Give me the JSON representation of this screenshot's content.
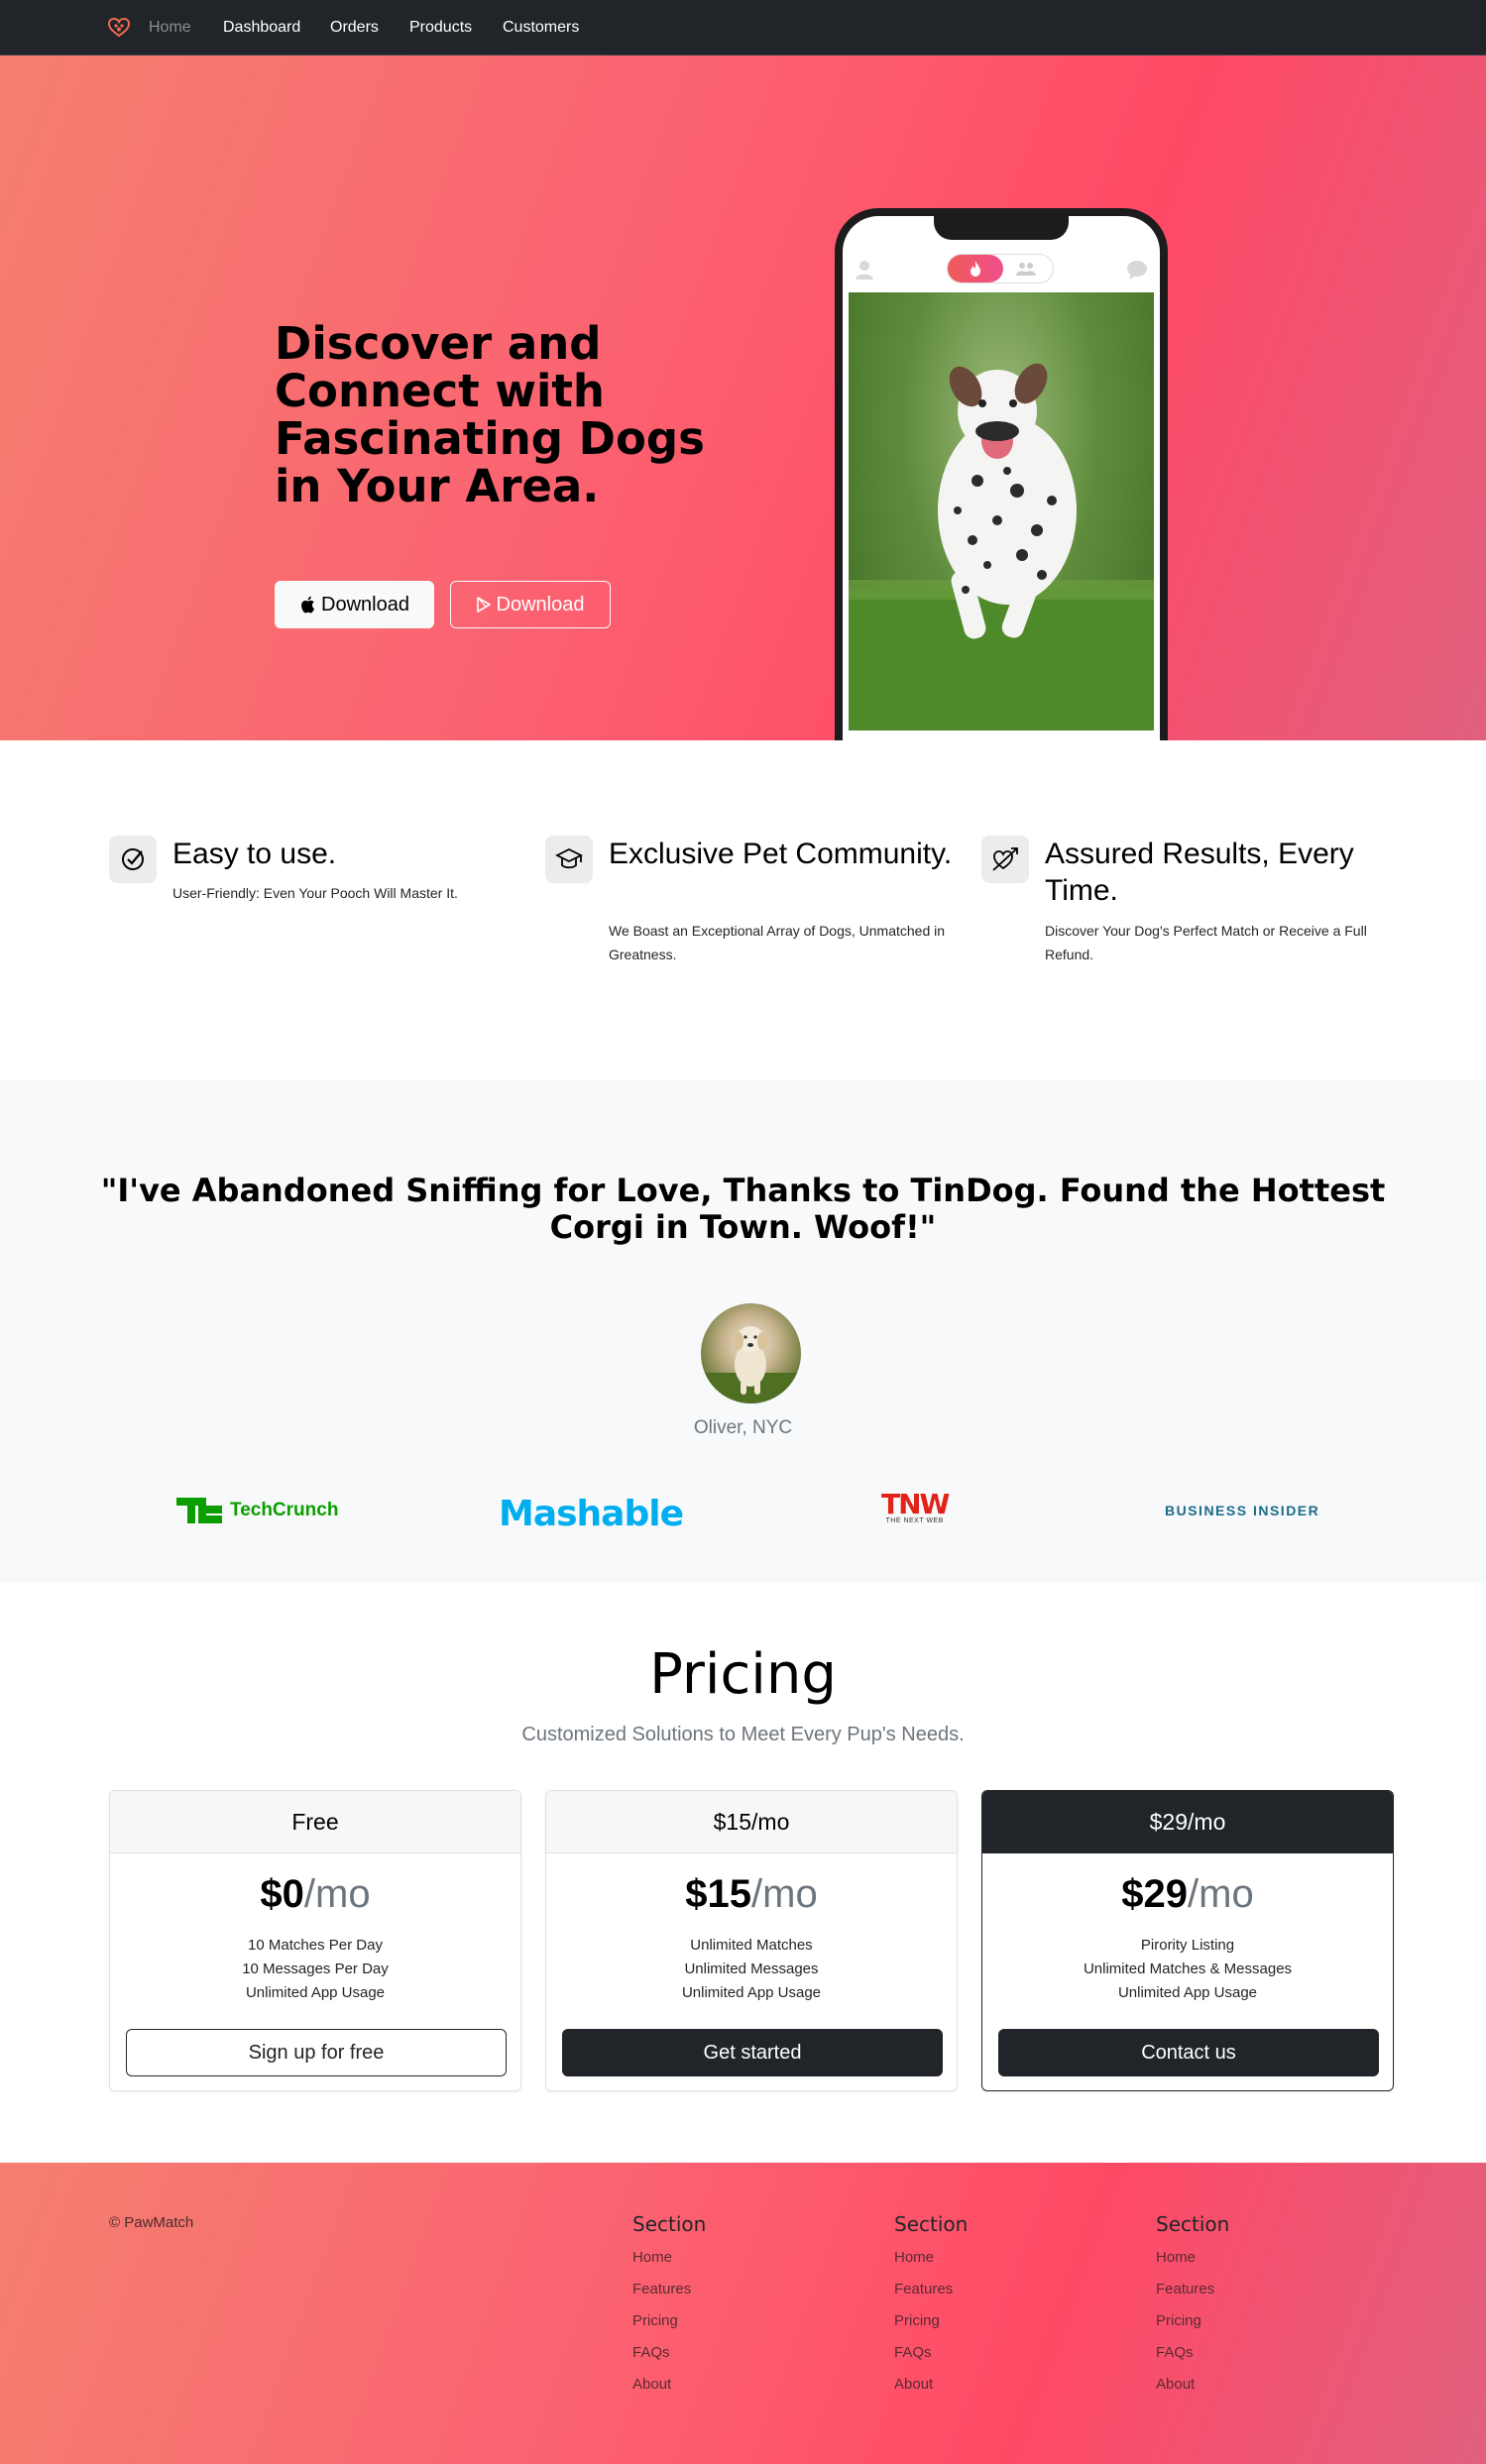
{
  "nav": {
    "brand_icon": "heart-paw-icon",
    "items": [
      {
        "label": "Home",
        "active": true
      },
      {
        "label": "Dashboard"
      },
      {
        "label": "Orders"
      },
      {
        "label": "Products"
      },
      {
        "label": "Customers"
      }
    ]
  },
  "hero": {
    "title": "Discover and Connect with Fascinating Dogs in Your Area.",
    "buttons": [
      {
        "label": "Download",
        "icon": "apple-icon"
      },
      {
        "label": "Download",
        "icon": "google-play-icon"
      }
    ]
  },
  "features": [
    {
      "title": "Easy to use.",
      "text": "User-Friendly: Even Your Pooch Will Master It.",
      "icon": "check-circle-icon"
    },
    {
      "title": "Exclusive Pet Community.",
      "text": "We Boast an Exceptional Array of Dogs, Unmatched in Greatness.",
      "icon": "graduation-cap-icon"
    },
    {
      "title": "Assured Results, Every Time.",
      "text": "Discover Your Dog's Perfect Match or Receive a Full Refund.",
      "icon": "heart-arrow-icon"
    }
  ],
  "testimonial": {
    "quote": "\"I've Abandoned Sniffing for Love, Thanks to TinDog. Found the Hottest Corgi in Town. Woof!\"",
    "author": "Oliver, NYC",
    "logos": [
      {
        "name": "TechCrunch",
        "mark": "TC",
        "color": "#0a9e01"
      },
      {
        "name": "Mashable",
        "color": "#00aeef"
      },
      {
        "name": "TNW",
        "sub": "THE NEXT WEB",
        "color": "#e2231a"
      },
      {
        "name": "BUSINESS INSIDER",
        "color": "#1b6b8a"
      }
    ]
  },
  "pricing": {
    "title": "Pricing",
    "subtitle": "Customized Solutions to Meet Every Pup's Needs.",
    "plans": [
      {
        "header": "Free",
        "amount": "$0",
        "per": "/mo",
        "features": [
          "10 Matches Per Day",
          "10 Messages Per Day",
          "Unlimited App Usage"
        ],
        "button": "Sign up for free"
      },
      {
        "header": "$15/mo",
        "amount": "$15",
        "per": "/mo",
        "features": [
          "Unlimited Matches",
          "Unlimited Messages",
          "Unlimited App Usage"
        ],
        "button": "Get started"
      },
      {
        "header": "$29/mo",
        "amount": "$29",
        "per": "/mo",
        "features": [
          "Pirority Listing",
          "Unlimited Matches & Messages",
          "Unlimited App Usage"
        ],
        "button": "Contact us"
      }
    ]
  },
  "footer": {
    "copyright": "© PawMatch",
    "columns": [
      {
        "title": "Section",
        "links": [
          "Home",
          "Features",
          "Pricing",
          "FAQs",
          "About"
        ]
      },
      {
        "title": "Section",
        "links": [
          "Home",
          "Features",
          "Pricing",
          "FAQs",
          "About"
        ]
      },
      {
        "title": "Section",
        "links": [
          "Home",
          "Features",
          "Pricing",
          "FAQs",
          "About"
        ]
      }
    ]
  },
  "colors": {
    "accent": "#ff4a66",
    "dark": "#212529",
    "muted": "#6c757d"
  }
}
